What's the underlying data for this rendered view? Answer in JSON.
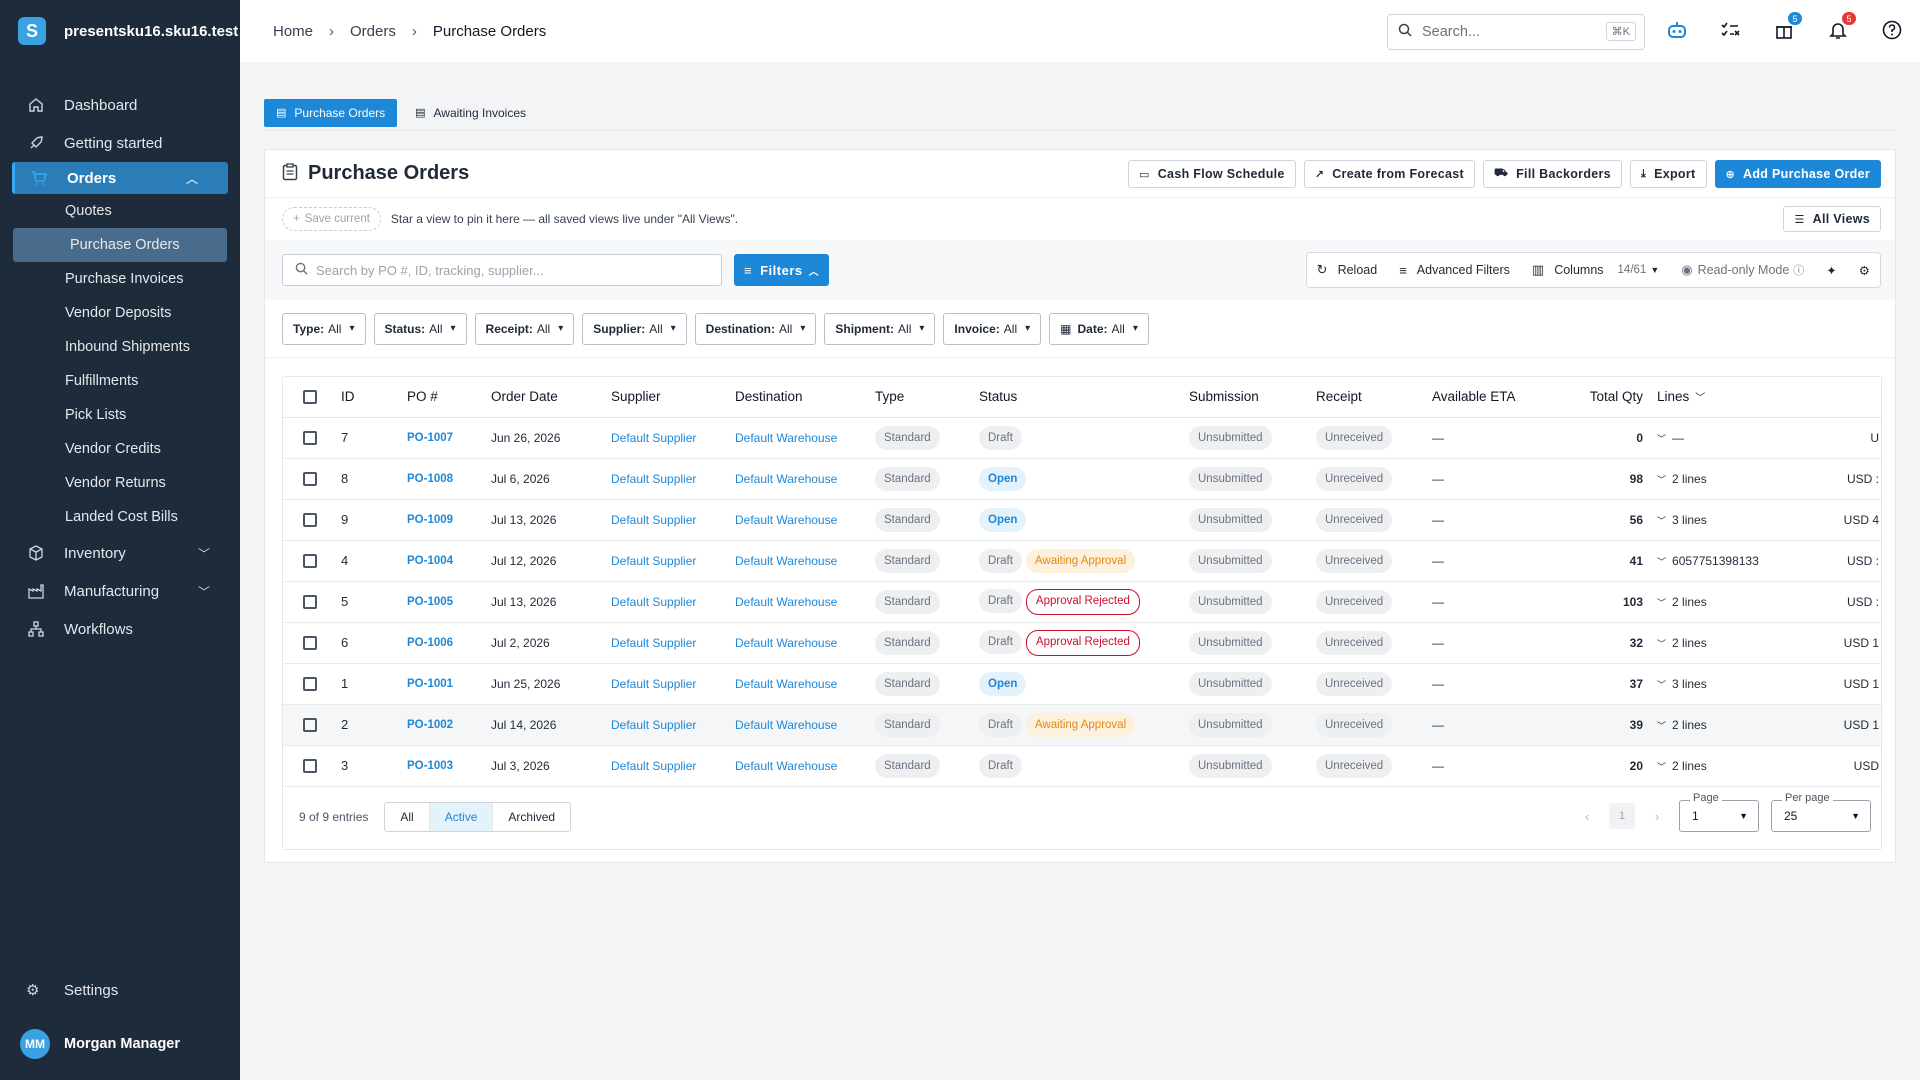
{
  "app": {
    "workspace": "presentsku16.sku16.test",
    "logo_letter": "S"
  },
  "sidebar": {
    "items": [
      {
        "label": "Dashboard",
        "icon": "home-icon"
      },
      {
        "label": "Getting started",
        "icon": "rocket-icon"
      },
      {
        "label": "Orders",
        "icon": "cart-icon",
        "active": true
      },
      {
        "label": "Inventory",
        "icon": "box-icon"
      },
      {
        "label": "Manufacturing",
        "icon": "factory-icon"
      },
      {
        "label": "Workflows",
        "icon": "workflow-icon"
      }
    ],
    "orders_sub": [
      "Quotes",
      "Purchase Orders",
      "Purchase Invoices",
      "Vendor Deposits",
      "Inbound Shipments",
      "Fulfillments",
      "Pick Lists",
      "Vendor Credits",
      "Vendor Returns",
      "Landed Cost Bills"
    ],
    "settings": "Settings",
    "user": {
      "initials": "MM",
      "name": "Morgan Manager"
    }
  },
  "topbar": {
    "breadcrumb": [
      "Home",
      "Orders",
      "Purchase Orders"
    ],
    "search_placeholder": "Search...",
    "search_shortcut": "⌘K",
    "gift_badge": "5",
    "bell_badge": "5"
  },
  "page_tabs": [
    "Purchase Orders",
    "Awaiting Invoices"
  ],
  "card": {
    "title": "Purchase Orders",
    "actions": [
      "Cash Flow Schedule",
      "Create from Forecast",
      "Fill Backorders",
      "Export",
      "Add Purchase Order"
    ],
    "save_current": "Save current",
    "views_hint": "Star a view to pin it here — all saved views live under \"All Views\".",
    "all_views": "All Views",
    "search_placeholder": "Search by PO #, ID, tracking, supplier...",
    "filters_label": "Filters",
    "reload": "Reload",
    "advanced_filters": "Advanced Filters",
    "columns": "Columns",
    "columns_count": "14/61",
    "read_only": "Read-only Mode"
  },
  "filters": [
    {
      "name": "Type:",
      "value": "All"
    },
    {
      "name": "Status:",
      "value": "All"
    },
    {
      "name": "Receipt:",
      "value": "All"
    },
    {
      "name": "Supplier:",
      "value": "All"
    },
    {
      "name": "Destination:",
      "value": "All"
    },
    {
      "name": "Shipment:",
      "value": "All"
    },
    {
      "name": "Invoice:",
      "value": "All"
    },
    {
      "name": "Date:",
      "value": "All"
    }
  ],
  "table": {
    "headers": [
      "ID",
      "PO #",
      "Order Date",
      "Supplier",
      "Destination",
      "Type",
      "Status",
      "Submission",
      "Receipt",
      "Available ETA",
      "Total Qty",
      "Lines"
    ],
    "rows": [
      {
        "id": "7",
        "po": "PO-1007",
        "date": "Jun 26, 2026",
        "supplier": "Default Supplier",
        "dest": "Default Warehouse",
        "type": "Standard",
        "status": "Draft",
        "extra": "",
        "submission": "Unsubmitted",
        "receipt": "Unreceived",
        "eta": "—",
        "qty": "0",
        "lines": "—",
        "total": "U"
      },
      {
        "id": "8",
        "po": "PO-1008",
        "date": "Jul 6, 2026",
        "supplier": "Default Supplier",
        "dest": "Default Warehouse",
        "type": "Standard",
        "status": "Open",
        "extra": "",
        "submission": "Unsubmitted",
        "receipt": "Unreceived",
        "eta": "—",
        "qty": "98",
        "lines": "2 lines",
        "total": "USD :"
      },
      {
        "id": "9",
        "po": "PO-1009",
        "date": "Jul 13, 2026",
        "supplier": "Default Supplier",
        "dest": "Default Warehouse",
        "type": "Standard",
        "status": "Open",
        "extra": "",
        "submission": "Unsubmitted",
        "receipt": "Unreceived",
        "eta": "—",
        "qty": "56",
        "lines": "3 lines",
        "total": "USD 4"
      },
      {
        "id": "4",
        "po": "PO-1004",
        "date": "Jul 12, 2026",
        "supplier": "Default Supplier",
        "dest": "Default Warehouse",
        "type": "Standard",
        "status": "Draft",
        "extra": "Awaiting Approval",
        "submission": "Unsubmitted",
        "receipt": "Unreceived",
        "eta": "—",
        "qty": "41",
        "lines": "6057751398133",
        "total": "USD :"
      },
      {
        "id": "5",
        "po": "PO-1005",
        "date": "Jul 13, 2026",
        "supplier": "Default Supplier",
        "dest": "Default Warehouse",
        "type": "Standard",
        "status": "Draft",
        "extra": "Approval Rejected",
        "submission": "Unsubmitted",
        "receipt": "Unreceived",
        "eta": "—",
        "qty": "103",
        "lines": "2 lines",
        "total": "USD :"
      },
      {
        "id": "6",
        "po": "PO-1006",
        "date": "Jul 2, 2026",
        "supplier": "Default Supplier",
        "dest": "Default Warehouse",
        "type": "Standard",
        "status": "Draft",
        "extra": "Approval Rejected",
        "submission": "Unsubmitted",
        "receipt": "Unreceived",
        "eta": "—",
        "qty": "32",
        "lines": "2 lines",
        "total": "USD 1"
      },
      {
        "id": "1",
        "po": "PO-1001",
        "date": "Jun 25, 2026",
        "supplier": "Default Supplier",
        "dest": "Default Warehouse",
        "type": "Standard",
        "status": "Open",
        "extra": "",
        "submission": "Unsubmitted",
        "receipt": "Unreceived",
        "eta": "—",
        "qty": "37",
        "lines": "3 lines",
        "total": "USD 1"
      },
      {
        "id": "2",
        "po": "PO-1002",
        "date": "Jul 14, 2026",
        "supplier": "Default Supplier",
        "dest": "Default Warehouse",
        "type": "Standard",
        "status": "Draft",
        "extra": "Awaiting Approval",
        "submission": "Unsubmitted",
        "receipt": "Unreceived",
        "eta": "—",
        "qty": "39",
        "lines": "2 lines",
        "total": "USD 1"
      },
      {
        "id": "3",
        "po": "PO-1003",
        "date": "Jul 3, 2026",
        "supplier": "Default Supplier",
        "dest": "Default Warehouse",
        "type": "Standard",
        "status": "Draft",
        "extra": "",
        "submission": "Unsubmitted",
        "receipt": "Unreceived",
        "eta": "—",
        "qty": "20",
        "lines": "2 lines",
        "total": "USD"
      }
    ]
  },
  "footer": {
    "entries": "9 of 9 entries",
    "segments": [
      "All",
      "Active",
      "Archived"
    ],
    "current_page": "1",
    "page_label": "Page",
    "page_value": "1",
    "per_page_label": "Per page",
    "per_page_value": "25"
  },
  "colors": {
    "sidebar": "#1e2b3a",
    "accent": "#1e88d8",
    "warning": "#e58a12",
    "danger": "#c8102e"
  }
}
